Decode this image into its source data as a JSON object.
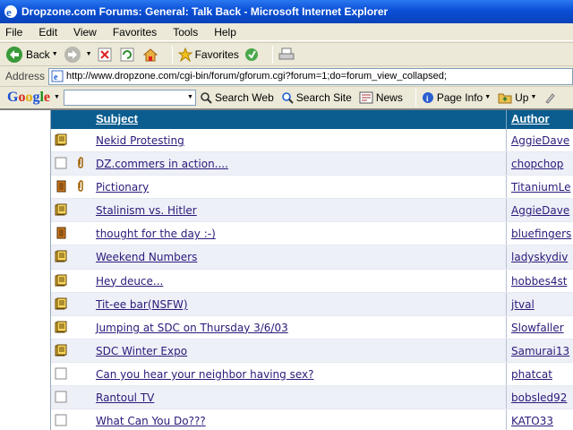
{
  "window": {
    "title": "Dropzone.com Forums: General: Talk Back - Microsoft Internet Explorer"
  },
  "menu": [
    "File",
    "Edit",
    "View",
    "Favorites",
    "Tools",
    "Help"
  ],
  "toolbar": {
    "back": "Back",
    "favorites": "Favorites"
  },
  "address": {
    "label": "Address",
    "url": "http://www.dropzone.com/cgi-bin/forum/gforum.cgi?forum=1;do=forum_view_collapsed;"
  },
  "google": {
    "logo": [
      "G",
      "o",
      "o",
      "g",
      "l",
      "e"
    ],
    "search_web": "Search Web",
    "search_site": "Search Site",
    "news": "News",
    "page_info": "Page Info",
    "up": "Up"
  },
  "table": {
    "col_subject": "Subject",
    "col_author": "Author",
    "rows": [
      {
        "subject": "Nekid Protesting",
        "author": "AggieDave",
        "icon": "thread-new",
        "attach": false
      },
      {
        "subject": "DZ.commers in action....",
        "author": "chopchop",
        "icon": "thread-empty",
        "attach": true
      },
      {
        "subject": "Pictionary",
        "author": "TitaniumLe",
        "icon": "thread-hot",
        "attach": true
      },
      {
        "subject": "Stalinism vs. Hitler",
        "author": "AggieDave",
        "icon": "thread-new",
        "attach": false
      },
      {
        "subject": "thought for the day :-)",
        "author": "bluefingers",
        "icon": "thread-hot",
        "attach": false
      },
      {
        "subject": "Weekend Numbers",
        "author": "ladyskydiv",
        "icon": "thread-new",
        "attach": false
      },
      {
        "subject": "Hey deuce...",
        "author": "hobbes4st",
        "icon": "thread-new",
        "attach": false
      },
      {
        "subject": "Tit-ee bar(NSFW)",
        "author": "jtval",
        "icon": "thread-new",
        "attach": false
      },
      {
        "subject": "Jumping at SDC on Thursday 3/6/03",
        "author": "Slowfaller",
        "icon": "thread-new",
        "attach": false
      },
      {
        "subject": "SDC Winter Expo",
        "author": "Samurai13",
        "icon": "thread-new",
        "attach": false
      },
      {
        "subject": "Can you hear your neighbor having sex?",
        "author": "phatcat",
        "icon": "thread-empty",
        "attach": false
      },
      {
        "subject": "Rantoul TV",
        "author": "bobsled92",
        "icon": "thread-empty",
        "attach": false
      },
      {
        "subject": "What Can You Do???",
        "author": "KATO33",
        "icon": "thread-empty",
        "attach": false
      }
    ]
  }
}
